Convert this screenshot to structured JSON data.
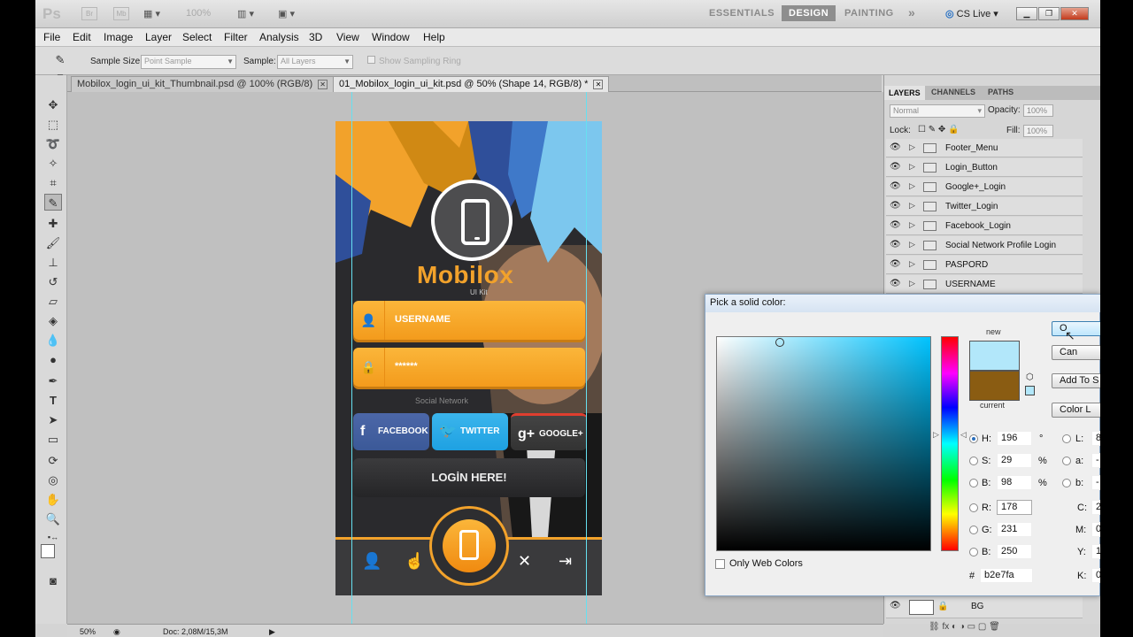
{
  "app": {
    "logo": "Ps",
    "bridge_buttons": [
      "Br",
      "Mb"
    ],
    "zoom": "100%",
    "workspaces": [
      "ESSENTIALS",
      "DESIGN",
      "PAINTING"
    ],
    "workspace_more": "»",
    "active_workspace": "DESIGN",
    "cs_live": "CS Live"
  },
  "menu": [
    "File",
    "Edit",
    "Image",
    "Layer",
    "Select",
    "Filter",
    "Analysis",
    "3D",
    "View",
    "Window",
    "Help"
  ],
  "options": {
    "sample_size_label": "Sample Size:",
    "sample_size_value": "Point Sample",
    "sample_label": "Sample:",
    "sample_value": "All Layers",
    "show_ring_label": "Show Sampling Ring"
  },
  "tabs": [
    {
      "label": "Mobilox_login_ui_kit_Thumbnail.psd @ 100% (RGB/8)",
      "active": false
    },
    {
      "label": "01_Mobilox_login_ui_kit.psd @ 50% (Shape 14, RGB/8) *",
      "active": true
    }
  ],
  "artboard": {
    "brand_left": "Mob",
    "brand_right": "ox",
    "brand_sub": "UI Kit",
    "username_placeholder": "USERNAME",
    "password_placeholder": "******",
    "social_label": "Social Network",
    "facebook": "FACEBOOK",
    "twitter": "TWITTER",
    "google": "GOOGLE+",
    "login": "LOGİN HERE!"
  },
  "status": {
    "zoom": "50%",
    "doc": "Doc: 2,08M/15,3M"
  },
  "layers_panel": {
    "tabs": [
      "LAYERS",
      "CHANNELS",
      "PATHS"
    ],
    "blend_mode": "Normal",
    "opacity_label": "Opacity:",
    "opacity": "100%",
    "lock_label": "Lock:",
    "fill_label": "Fill:",
    "fill": "100%",
    "layers": [
      "Footer_Menu",
      "Login_Button",
      "Google+_Login",
      "Twitter_Login",
      "Facebook_Login",
      "Social Network Profile Login",
      "PASPORD",
      "USERNAME"
    ],
    "bottom_layer": "BG"
  },
  "color_picker": {
    "title": "Pick a solid color:",
    "new_label": "new",
    "current_label": "current",
    "new_color": "#b2e7fa",
    "current_color": "#8a5c12",
    "only_web_colors": "Only Web Colors",
    "buttons": [
      "O",
      "Can",
      "Add To S",
      "Color L"
    ],
    "H": "196",
    "S": "29",
    "B": "98",
    "R": "178",
    "G": "231",
    "Bv": "250",
    "hex": "b2e7fa",
    "L": "8",
    "a": "-",
    "b": "-",
    "C": "2",
    "M": "0",
    "Y": "1",
    "K": "0",
    "deg": "°",
    "pct": "%"
  }
}
